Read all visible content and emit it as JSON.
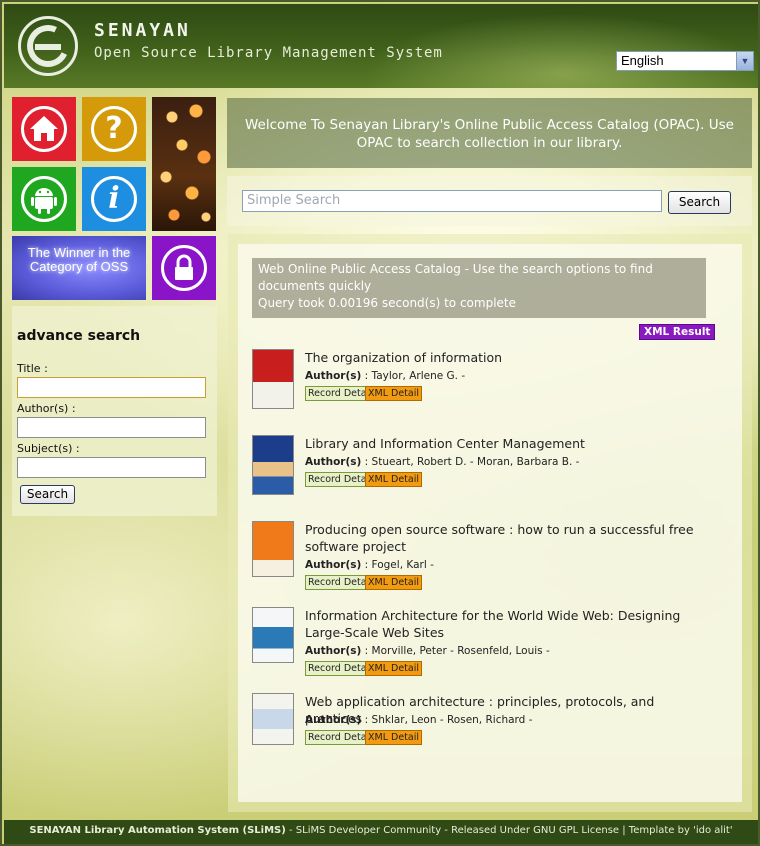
{
  "header": {
    "brand_name": "SENAYAN",
    "brand_subtitle": "Open Source Library Management System",
    "language": "English"
  },
  "tiles": {
    "winner_text": "The Winner in the Category of OSS"
  },
  "advance_search": {
    "heading": "advance search",
    "title_label": "Title :",
    "authors_label": "Author(s) :",
    "subject_label": "Subject(s) :",
    "search_button": "Search"
  },
  "welcome_text": "Welcome To Senayan Library's Online Public Access Catalog (OPAC). Use OPAC to search collection in our library.",
  "simple_search": {
    "placeholder": "Simple Search",
    "button": "Search"
  },
  "results": {
    "info_line1": "Web Online Public Access Catalog - Use the search options to find documents quickly",
    "info_line2": "Query took 0.00196 second(s) to complete",
    "xml_result": "XML Result",
    "author_label": "Author(s)",
    "record_detail": "Record Detail",
    "xml_detail": "XML Detail",
    "items": [
      {
        "title": "The organization of information",
        "authors": " : Taylor, Arlene G. -"
      },
      {
        "title": "Library and Information Center Management",
        "authors": " : Stueart, Robert D. - Moran, Barbara B. -"
      },
      {
        "title": "Producing open source software : how to run a successful free software project",
        "authors": " : Fogel, Karl -"
      },
      {
        "title": "Information Architecture for the World Wide Web: Designing Large-Scale Web Sites",
        "authors": " : Morville, Peter - Rosenfeld, Louis -"
      },
      {
        "title": "Web application architecture : principles, protocols, and practices",
        "authors": " : Shklar, Leon - Rosen, Richard -"
      }
    ]
  },
  "footer": {
    "bold": "SENAYAN Library Automation System (SLiMS)",
    "rest": " - SLiMS Developer Community - Released Under GNU GPL License | Template by  'ido alit'"
  },
  "colors": {
    "tile_home": "#e0202e",
    "tile_help": "#d49a0a",
    "tile_android": "#1fa81f",
    "tile_info": "#1e8fe0",
    "tile_lock": "#8a14c8",
    "xml_detail": "#f29a10",
    "xml_result": "#8a1ac0"
  },
  "icons": [
    "home-icon",
    "help-icon",
    "android-icon",
    "info-icon",
    "lock-icon"
  ]
}
